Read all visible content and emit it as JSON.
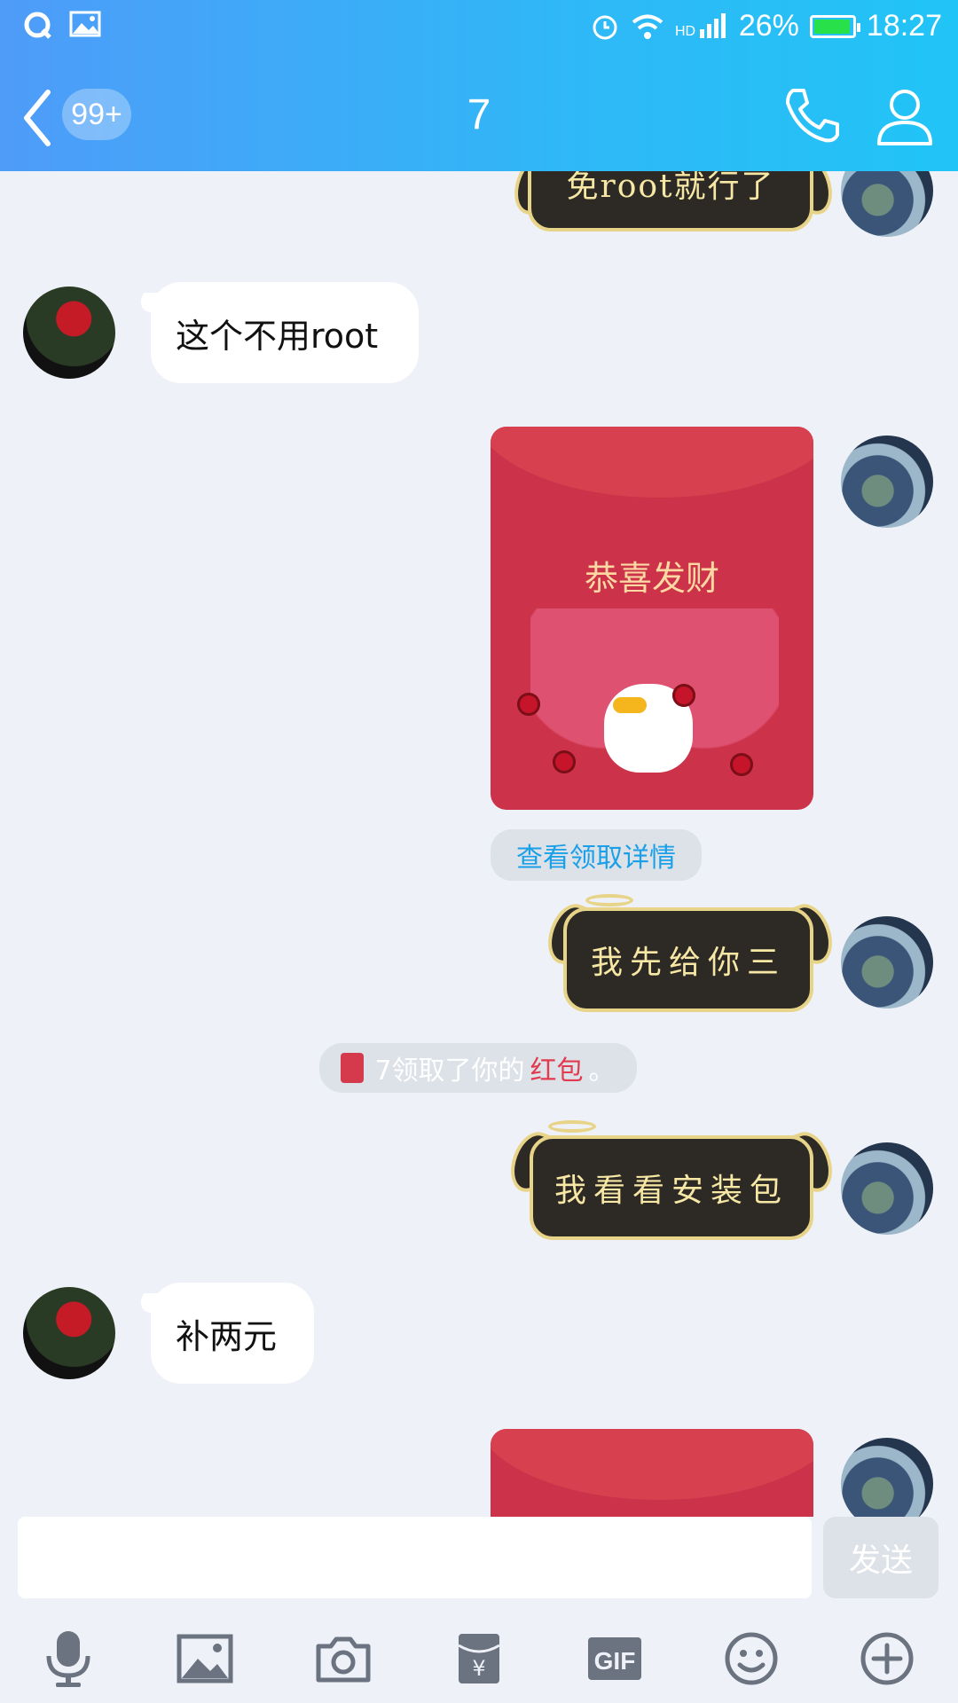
{
  "status_bar": {
    "battery": "26%",
    "time": "18:27"
  },
  "header": {
    "unread_badge": "99+",
    "title": "7"
  },
  "messages": {
    "m0_text": "免root就行了",
    "m1_text": "这个不用root",
    "redpacket1_wish": "恭喜发财",
    "redpacket1_detail": "查看领取详情",
    "m3_text": "我先给你三",
    "system_prefix": "7领取了你的",
    "system_highlight": "红包",
    "system_suffix": "。",
    "m4_text": "我看看安装包",
    "m5_text": "补两元"
  },
  "input": {
    "placeholder": "",
    "send_label": "发送"
  },
  "toolbar": [
    "mic-icon",
    "image-icon",
    "camera-icon",
    "red-packet-icon",
    "gif-icon",
    "emoji-icon",
    "plus-icon"
  ],
  "colors": {
    "header_start": "#4e9cf8",
    "header_end": "#21c4f6",
    "red_packet": "#cc3249",
    "bubble_dark": "#2d2a26",
    "bubble_gold": "#e8d488",
    "link": "#1aa0e8"
  }
}
